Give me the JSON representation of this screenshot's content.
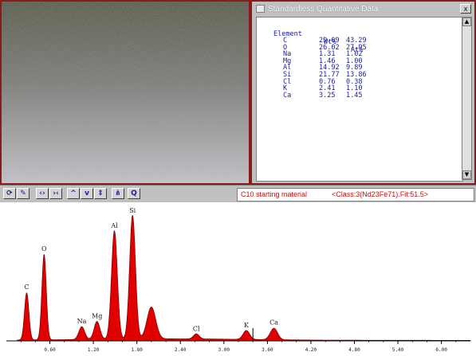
{
  "quant_window": {
    "title": "Standardless Quantitative Data",
    "close_label": "x",
    "col_element": "Element",
    "col_wt": "Wt%",
    "col_at": "At%",
    "rows": [
      {
        "el": "C",
        "wt": "29.09",
        "at": "43.29"
      },
      {
        "el": "O",
        "wt": "26.02",
        "at": "27.95"
      },
      {
        "el": "Na",
        "wt": "1.31",
        "at": "1.02"
      },
      {
        "el": "Mg",
        "wt": "1.46",
        "at": "1.00"
      },
      {
        "el": "Al",
        "wt": "14.92",
        "at": "9.89"
      },
      {
        "el": "Si",
        "wt": "21.77",
        "at": "13.86"
      },
      {
        "el": "Cl",
        "wt": "0.76",
        "at": "0.38"
      },
      {
        "el": "K",
        "wt": "2.41",
        "at": "1.10"
      },
      {
        "el": "Ca",
        "wt": "3.25",
        "at": "1.45"
      }
    ]
  },
  "toolbar": {
    "spectrum_label": "C10 starting material",
    "classify_text": "<Class:3(Nd23Fe71).Fit:51.5>"
  },
  "spectrum": {
    "colors": {
      "fill": "#e00000",
      "outline": "#8b0000",
      "text": "#1a1a1a",
      "axis": "#000000"
    },
    "x_range_kev": [
      0,
      6.4
    ],
    "x_ticks": [
      "0.60",
      "1.20",
      "1.80",
      "2.40",
      "3.00",
      "3.60",
      "4.20",
      "4.80",
      "5.40",
      "6.00"
    ],
    "x_tick_values": [
      0.6,
      1.2,
      1.8,
      2.4,
      3.0,
      3.6,
      4.2,
      4.8,
      5.4,
      6.0
    ],
    "peaks": [
      {
        "label": "C",
        "kev": 0.28,
        "height": 0.37,
        "width": 0.03
      },
      {
        "label": "O",
        "kev": 0.52,
        "height": 0.67,
        "width": 0.03
      },
      {
        "label": "Na",
        "kev": 1.04,
        "height": 0.1,
        "width": 0.04
      },
      {
        "label": "Mg",
        "kev": 1.25,
        "height": 0.14,
        "width": 0.04
      },
      {
        "label": "Al",
        "kev": 1.49,
        "height": 0.85,
        "width": 0.04
      },
      {
        "label": "Si",
        "kev": 1.74,
        "height": 0.97,
        "width": 0.04
      },
      {
        "label": "",
        "kev": 2.0,
        "height": 0.25,
        "width": 0.06
      },
      {
        "label": "Cl",
        "kev": 2.62,
        "height": 0.04,
        "width": 0.04
      },
      {
        "label": "K",
        "kev": 3.31,
        "height": 0.07,
        "width": 0.045
      },
      {
        "label": "Ca",
        "kev": 3.69,
        "height": 0.09,
        "width": 0.05
      }
    ],
    "marker_kev": 3.4
  },
  "micrograph": {
    "colors": {
      "top": "#595a4a",
      "mid": "#7b7b78",
      "bottom": "#c2c2c8"
    }
  }
}
